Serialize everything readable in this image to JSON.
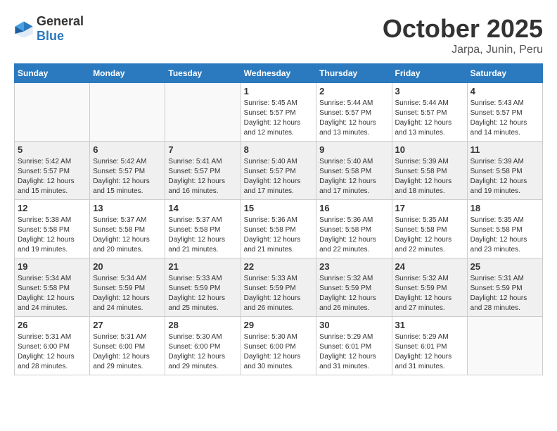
{
  "header": {
    "logo_general": "General",
    "logo_blue": "Blue",
    "month": "October 2025",
    "location": "Jarpa, Junin, Peru"
  },
  "weekdays": [
    "Sunday",
    "Monday",
    "Tuesday",
    "Wednesday",
    "Thursday",
    "Friday",
    "Saturday"
  ],
  "weeks": [
    [
      {
        "day": "",
        "info": ""
      },
      {
        "day": "",
        "info": ""
      },
      {
        "day": "",
        "info": ""
      },
      {
        "day": "1",
        "info": "Sunrise: 5:45 AM\nSunset: 5:57 PM\nDaylight: 12 hours\nand 12 minutes."
      },
      {
        "day": "2",
        "info": "Sunrise: 5:44 AM\nSunset: 5:57 PM\nDaylight: 12 hours\nand 13 minutes."
      },
      {
        "day": "3",
        "info": "Sunrise: 5:44 AM\nSunset: 5:57 PM\nDaylight: 12 hours\nand 13 minutes."
      },
      {
        "day": "4",
        "info": "Sunrise: 5:43 AM\nSunset: 5:57 PM\nDaylight: 12 hours\nand 14 minutes."
      }
    ],
    [
      {
        "day": "5",
        "info": "Sunrise: 5:42 AM\nSunset: 5:57 PM\nDaylight: 12 hours\nand 15 minutes."
      },
      {
        "day": "6",
        "info": "Sunrise: 5:42 AM\nSunset: 5:57 PM\nDaylight: 12 hours\nand 15 minutes."
      },
      {
        "day": "7",
        "info": "Sunrise: 5:41 AM\nSunset: 5:57 PM\nDaylight: 12 hours\nand 16 minutes."
      },
      {
        "day": "8",
        "info": "Sunrise: 5:40 AM\nSunset: 5:57 PM\nDaylight: 12 hours\nand 17 minutes."
      },
      {
        "day": "9",
        "info": "Sunrise: 5:40 AM\nSunset: 5:58 PM\nDaylight: 12 hours\nand 17 minutes."
      },
      {
        "day": "10",
        "info": "Sunrise: 5:39 AM\nSunset: 5:58 PM\nDaylight: 12 hours\nand 18 minutes."
      },
      {
        "day": "11",
        "info": "Sunrise: 5:39 AM\nSunset: 5:58 PM\nDaylight: 12 hours\nand 19 minutes."
      }
    ],
    [
      {
        "day": "12",
        "info": "Sunrise: 5:38 AM\nSunset: 5:58 PM\nDaylight: 12 hours\nand 19 minutes."
      },
      {
        "day": "13",
        "info": "Sunrise: 5:37 AM\nSunset: 5:58 PM\nDaylight: 12 hours\nand 20 minutes."
      },
      {
        "day": "14",
        "info": "Sunrise: 5:37 AM\nSunset: 5:58 PM\nDaylight: 12 hours\nand 21 minutes."
      },
      {
        "day": "15",
        "info": "Sunrise: 5:36 AM\nSunset: 5:58 PM\nDaylight: 12 hours\nand 21 minutes."
      },
      {
        "day": "16",
        "info": "Sunrise: 5:36 AM\nSunset: 5:58 PM\nDaylight: 12 hours\nand 22 minutes."
      },
      {
        "day": "17",
        "info": "Sunrise: 5:35 AM\nSunset: 5:58 PM\nDaylight: 12 hours\nand 22 minutes."
      },
      {
        "day": "18",
        "info": "Sunrise: 5:35 AM\nSunset: 5:58 PM\nDaylight: 12 hours\nand 23 minutes."
      }
    ],
    [
      {
        "day": "19",
        "info": "Sunrise: 5:34 AM\nSunset: 5:58 PM\nDaylight: 12 hours\nand 24 minutes."
      },
      {
        "day": "20",
        "info": "Sunrise: 5:34 AM\nSunset: 5:59 PM\nDaylight: 12 hours\nand 24 minutes."
      },
      {
        "day": "21",
        "info": "Sunrise: 5:33 AM\nSunset: 5:59 PM\nDaylight: 12 hours\nand 25 minutes."
      },
      {
        "day": "22",
        "info": "Sunrise: 5:33 AM\nSunset: 5:59 PM\nDaylight: 12 hours\nand 26 minutes."
      },
      {
        "day": "23",
        "info": "Sunrise: 5:32 AM\nSunset: 5:59 PM\nDaylight: 12 hours\nand 26 minutes."
      },
      {
        "day": "24",
        "info": "Sunrise: 5:32 AM\nSunset: 5:59 PM\nDaylight: 12 hours\nand 27 minutes."
      },
      {
        "day": "25",
        "info": "Sunrise: 5:31 AM\nSunset: 5:59 PM\nDaylight: 12 hours\nand 28 minutes."
      }
    ],
    [
      {
        "day": "26",
        "info": "Sunrise: 5:31 AM\nSunset: 6:00 PM\nDaylight: 12 hours\nand 28 minutes."
      },
      {
        "day": "27",
        "info": "Sunrise: 5:31 AM\nSunset: 6:00 PM\nDaylight: 12 hours\nand 29 minutes."
      },
      {
        "day": "28",
        "info": "Sunrise: 5:30 AM\nSunset: 6:00 PM\nDaylight: 12 hours\nand 29 minutes."
      },
      {
        "day": "29",
        "info": "Sunrise: 5:30 AM\nSunset: 6:00 PM\nDaylight: 12 hours\nand 30 minutes."
      },
      {
        "day": "30",
        "info": "Sunrise: 5:29 AM\nSunset: 6:01 PM\nDaylight: 12 hours\nand 31 minutes."
      },
      {
        "day": "31",
        "info": "Sunrise: 5:29 AM\nSunset: 6:01 PM\nDaylight: 12 hours\nand 31 minutes."
      },
      {
        "day": "",
        "info": ""
      }
    ]
  ]
}
